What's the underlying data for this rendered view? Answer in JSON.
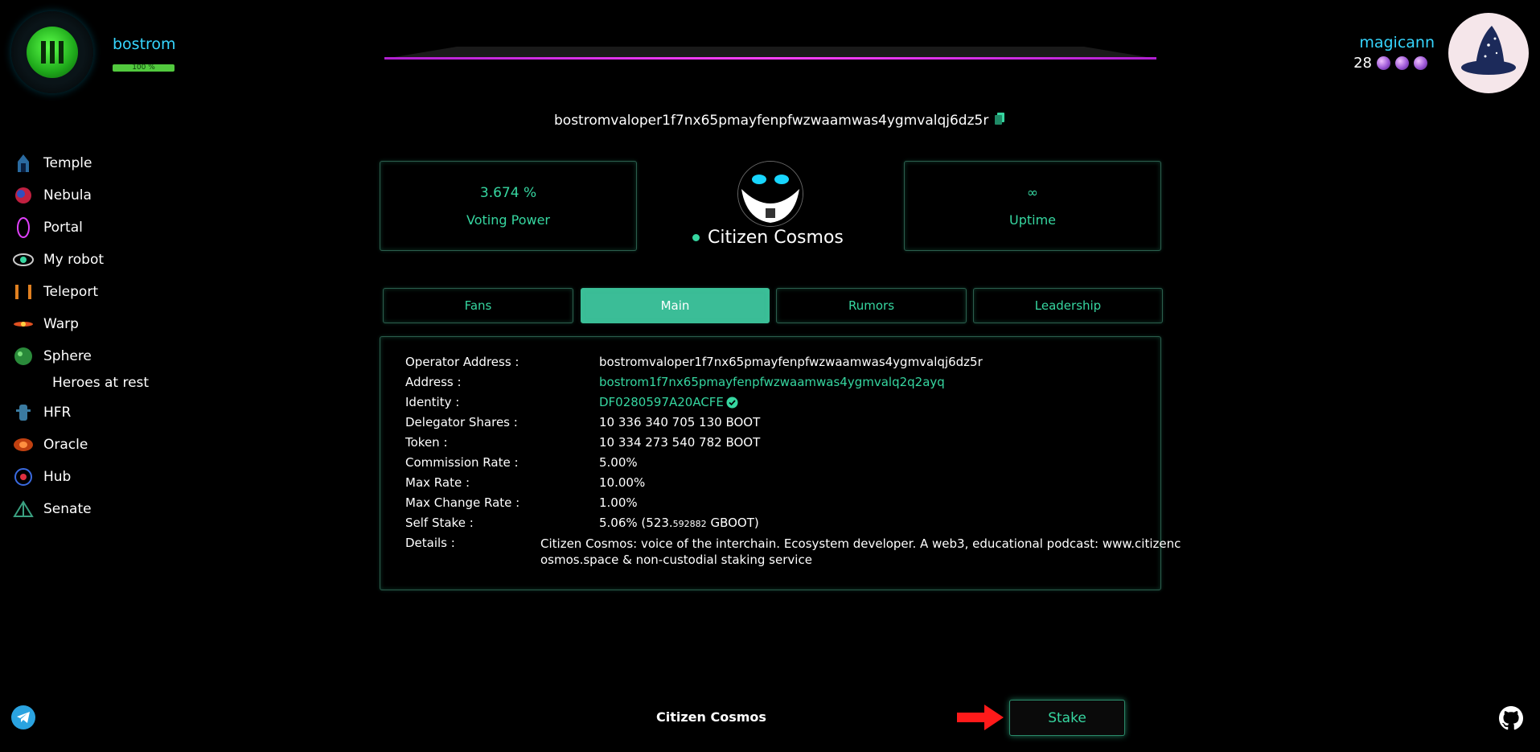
{
  "header": {
    "chain_name": "bostrom",
    "chain_progress_label": "100 %",
    "user_name": "magicann",
    "user_level": "28"
  },
  "sidebar": {
    "items": [
      {
        "label": "Temple",
        "icon": "temple-icon"
      },
      {
        "label": "Nebula",
        "icon": "nebula-icon"
      },
      {
        "label": "Portal",
        "icon": "portal-icon"
      },
      {
        "label": "My robot",
        "icon": "robot-eye-icon"
      },
      {
        "label": "Teleport",
        "icon": "teleport-icon"
      },
      {
        "label": "Warp",
        "icon": "warp-icon"
      },
      {
        "label": "Sphere",
        "icon": "sphere-icon"
      },
      {
        "label": "Heroes at rest",
        "icon": ""
      },
      {
        "label": "HFR",
        "icon": "hfr-icon"
      },
      {
        "label": "Oracle",
        "icon": "oracle-icon"
      },
      {
        "label": "Hub",
        "icon": "hub-icon"
      },
      {
        "label": "Senate",
        "icon": "senate-icon"
      }
    ]
  },
  "validator": {
    "operator_address": "bostromvaloper1f7nx65pmayfenpfwzwaamwas4ygmvalqj6dz5r",
    "moniker": "Citizen Cosmos",
    "voting_power_value": "3.674 %",
    "voting_power_label": "Voting Power",
    "uptime_value": "∞",
    "uptime_label": "Uptime"
  },
  "tabs": [
    {
      "label": "Fans",
      "active": false
    },
    {
      "label": "Main",
      "active": true
    },
    {
      "label": "Rumors",
      "active": false
    },
    {
      "label": "Leadership",
      "active": false
    }
  ],
  "details": {
    "operator_address_label": "Operator Address :",
    "operator_address": "bostromvaloper1f7nx65pmayfenpfwzwaamwas4ygmvalqj6dz5r",
    "address_label": "Address :",
    "address": "bostrom1f7nx65pmayfenpfwzwaamwas4ygmvalq2q2ayq",
    "identity_label": "Identity :",
    "identity": "DF0280597A20ACFE",
    "delegator_shares_label": "Delegator Shares :",
    "delegator_shares": "10 336 340 705 130 BOOT",
    "token_label": "Token :",
    "token": "10 334 273 540 782 BOOT",
    "commission_rate_label": "Commission Rate :",
    "commission_rate": "5.00%",
    "max_rate_label": "Max Rate :",
    "max_rate": "10.00%",
    "max_change_rate_label": "Max Change Rate :",
    "max_change_rate": "1.00%",
    "self_stake_label": "Self Stake :",
    "self_stake_main": "5.06% (523.",
    "self_stake_small": "592882",
    "self_stake_unit": " GBOOT)",
    "details_label": "Details :",
    "details_line1": "Citizen Cosmos: voice of the interchain. Ecosystem developer. A web3, educational podcast: www.citizenc",
    "details_line2": "osmos.space & non-custodial staking service"
  },
  "footer": {
    "title": "Citizen Cosmos",
    "stake_label": "Stake"
  },
  "colors": {
    "accent": "#36d6a0",
    "link_blue": "#36d6ff",
    "magenta_line": "#e040fb",
    "arrow_red": "#ff1a1a"
  }
}
